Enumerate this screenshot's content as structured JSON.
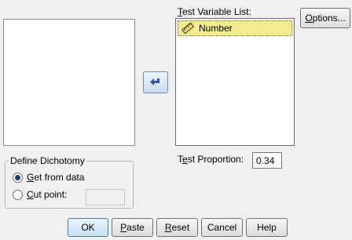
{
  "source_list": {
    "items": []
  },
  "test_list": {
    "label_underline": "T",
    "label_rest": "est Variable List:",
    "items": [
      {
        "label": "Number",
        "icon": "ruler-icon",
        "selected": true
      }
    ]
  },
  "options_button": {
    "underline": "O",
    "rest": "ptions..."
  },
  "define_dichotomy": {
    "legend": "Define Dichotomy",
    "get_from_data": {
      "underline": "G",
      "rest": "et from data",
      "checked": true
    },
    "cut_point": {
      "underline": "C",
      "rest": "ut point:",
      "checked": false,
      "value": ""
    }
  },
  "test_proportion": {
    "pre": "T",
    "underline": "e",
    "rest": "st Proportion:",
    "value": "0.34"
  },
  "footer": {
    "ok": "OK",
    "paste_underline": "P",
    "paste_rest": "aste",
    "reset_underline": "R",
    "reset_rest": "eset",
    "cancel": "Cancel",
    "help": "Help"
  },
  "colors": {
    "selection": "#f5eb8f",
    "arrow": "#2f5597"
  }
}
